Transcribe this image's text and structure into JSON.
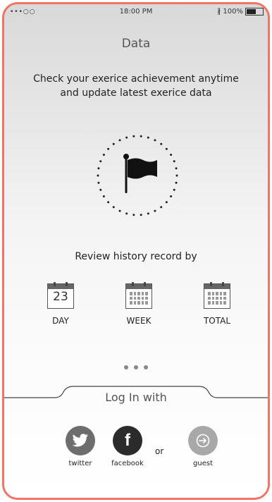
{
  "status_bar": {
    "signal": "•••○○",
    "time": "18:00 PM",
    "battery": "100%"
  },
  "header": {
    "title": "Data"
  },
  "intro": {
    "line1": "Check your exerice achievement anytime",
    "line2": "and update latest exerice data"
  },
  "hero_icon": "flag-icon",
  "review": {
    "title": "Review history record by",
    "options": [
      {
        "label": "DAY",
        "icon": "calendar-day-icon",
        "number": "23"
      },
      {
        "label": "WEEK",
        "icon": "calendar-week-icon"
      },
      {
        "label": "TOTAL",
        "icon": "calendar-total-icon"
      }
    ]
  },
  "pager": {
    "pages": 3
  },
  "login": {
    "title": "Log In with",
    "or": "or",
    "buttons": [
      {
        "label": "twitter",
        "icon": "twitter-icon",
        "color": "#6d6d6d"
      },
      {
        "label": "facebook",
        "icon": "facebook-icon",
        "color": "#2b2b2b"
      },
      {
        "label": "guest",
        "icon": "guest-login-icon",
        "color": "#a8a8a8"
      }
    ]
  },
  "colors": {
    "frame_border": "#f07468",
    "text": "#222222"
  }
}
